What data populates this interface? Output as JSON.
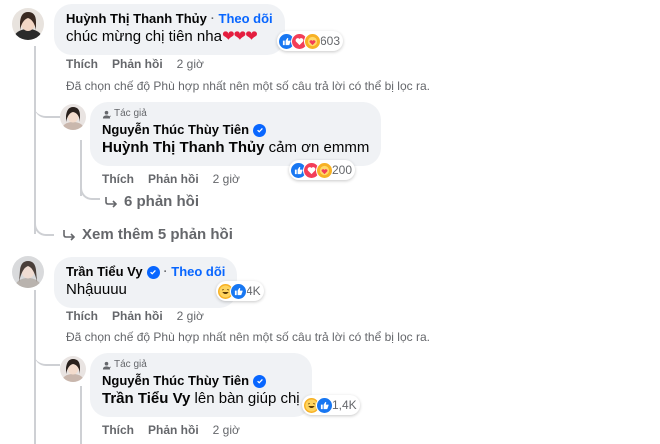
{
  "comments": [
    {
      "author": "Huỳnh Thị Thanh Thủy",
      "follow": "Theo dõi",
      "text": "chúc mừng chị tiên nha",
      "hearts": "❤❤❤",
      "reaction_count": "603",
      "reaction_icons": [
        "like-icon",
        "love-icon",
        "care-icon"
      ],
      "like": "Thích",
      "reply": "Phản hồi",
      "time": "2 giờ",
      "notice": "Đã chọn chế độ Phù hợp nhất nên một số câu trả lời có thể bị lọc ra.",
      "reply_item": {
        "author_tag": "Tác giả",
        "author": "Nguyễn Thúc Thùy Tiên",
        "mention": "Huỳnh Thị Thanh Thủy",
        "text": " cảm ơn emmm",
        "reaction_count": "200",
        "reaction_icons": [
          "like-icon",
          "love-icon",
          "care-icon"
        ],
        "like": "Thích",
        "reply": "Phản hồi",
        "time": "2 giờ",
        "more_replies": "6 phản hồi"
      },
      "see_more": "Xem thêm 5 phản hồi"
    },
    {
      "author": "Trần Tiểu Vy",
      "follow": "Theo dõi",
      "text": "Nhậuuuu",
      "reaction_count": "4K",
      "reaction_icons": [
        "haha-icon",
        "like-icon"
      ],
      "like": "Thích",
      "reply": "Phản hồi",
      "time": "2 giờ",
      "notice": "Đã chọn chế độ Phù hợp nhất nên một số câu trả lời có thể bị lọc ra.",
      "reply_item": {
        "author_tag": "Tác giả",
        "author": "Nguyễn Thúc Thùy Tiên",
        "mention": "Trần Tiểu Vy",
        "text": " lên bàn giúp chị",
        "reaction_count": "1,4K",
        "reaction_icons": [
          "haha-icon",
          "like-icon"
        ],
        "like": "Thích",
        "reply": "Phản hồi",
        "time": "2 giờ"
      }
    }
  ],
  "colors": {
    "accent": "#0866ff",
    "bubble": "#f0f2f5",
    "secondary_text": "#65676b",
    "like": "#1877f2",
    "love": "#f33e58",
    "care": "#f7b125"
  }
}
